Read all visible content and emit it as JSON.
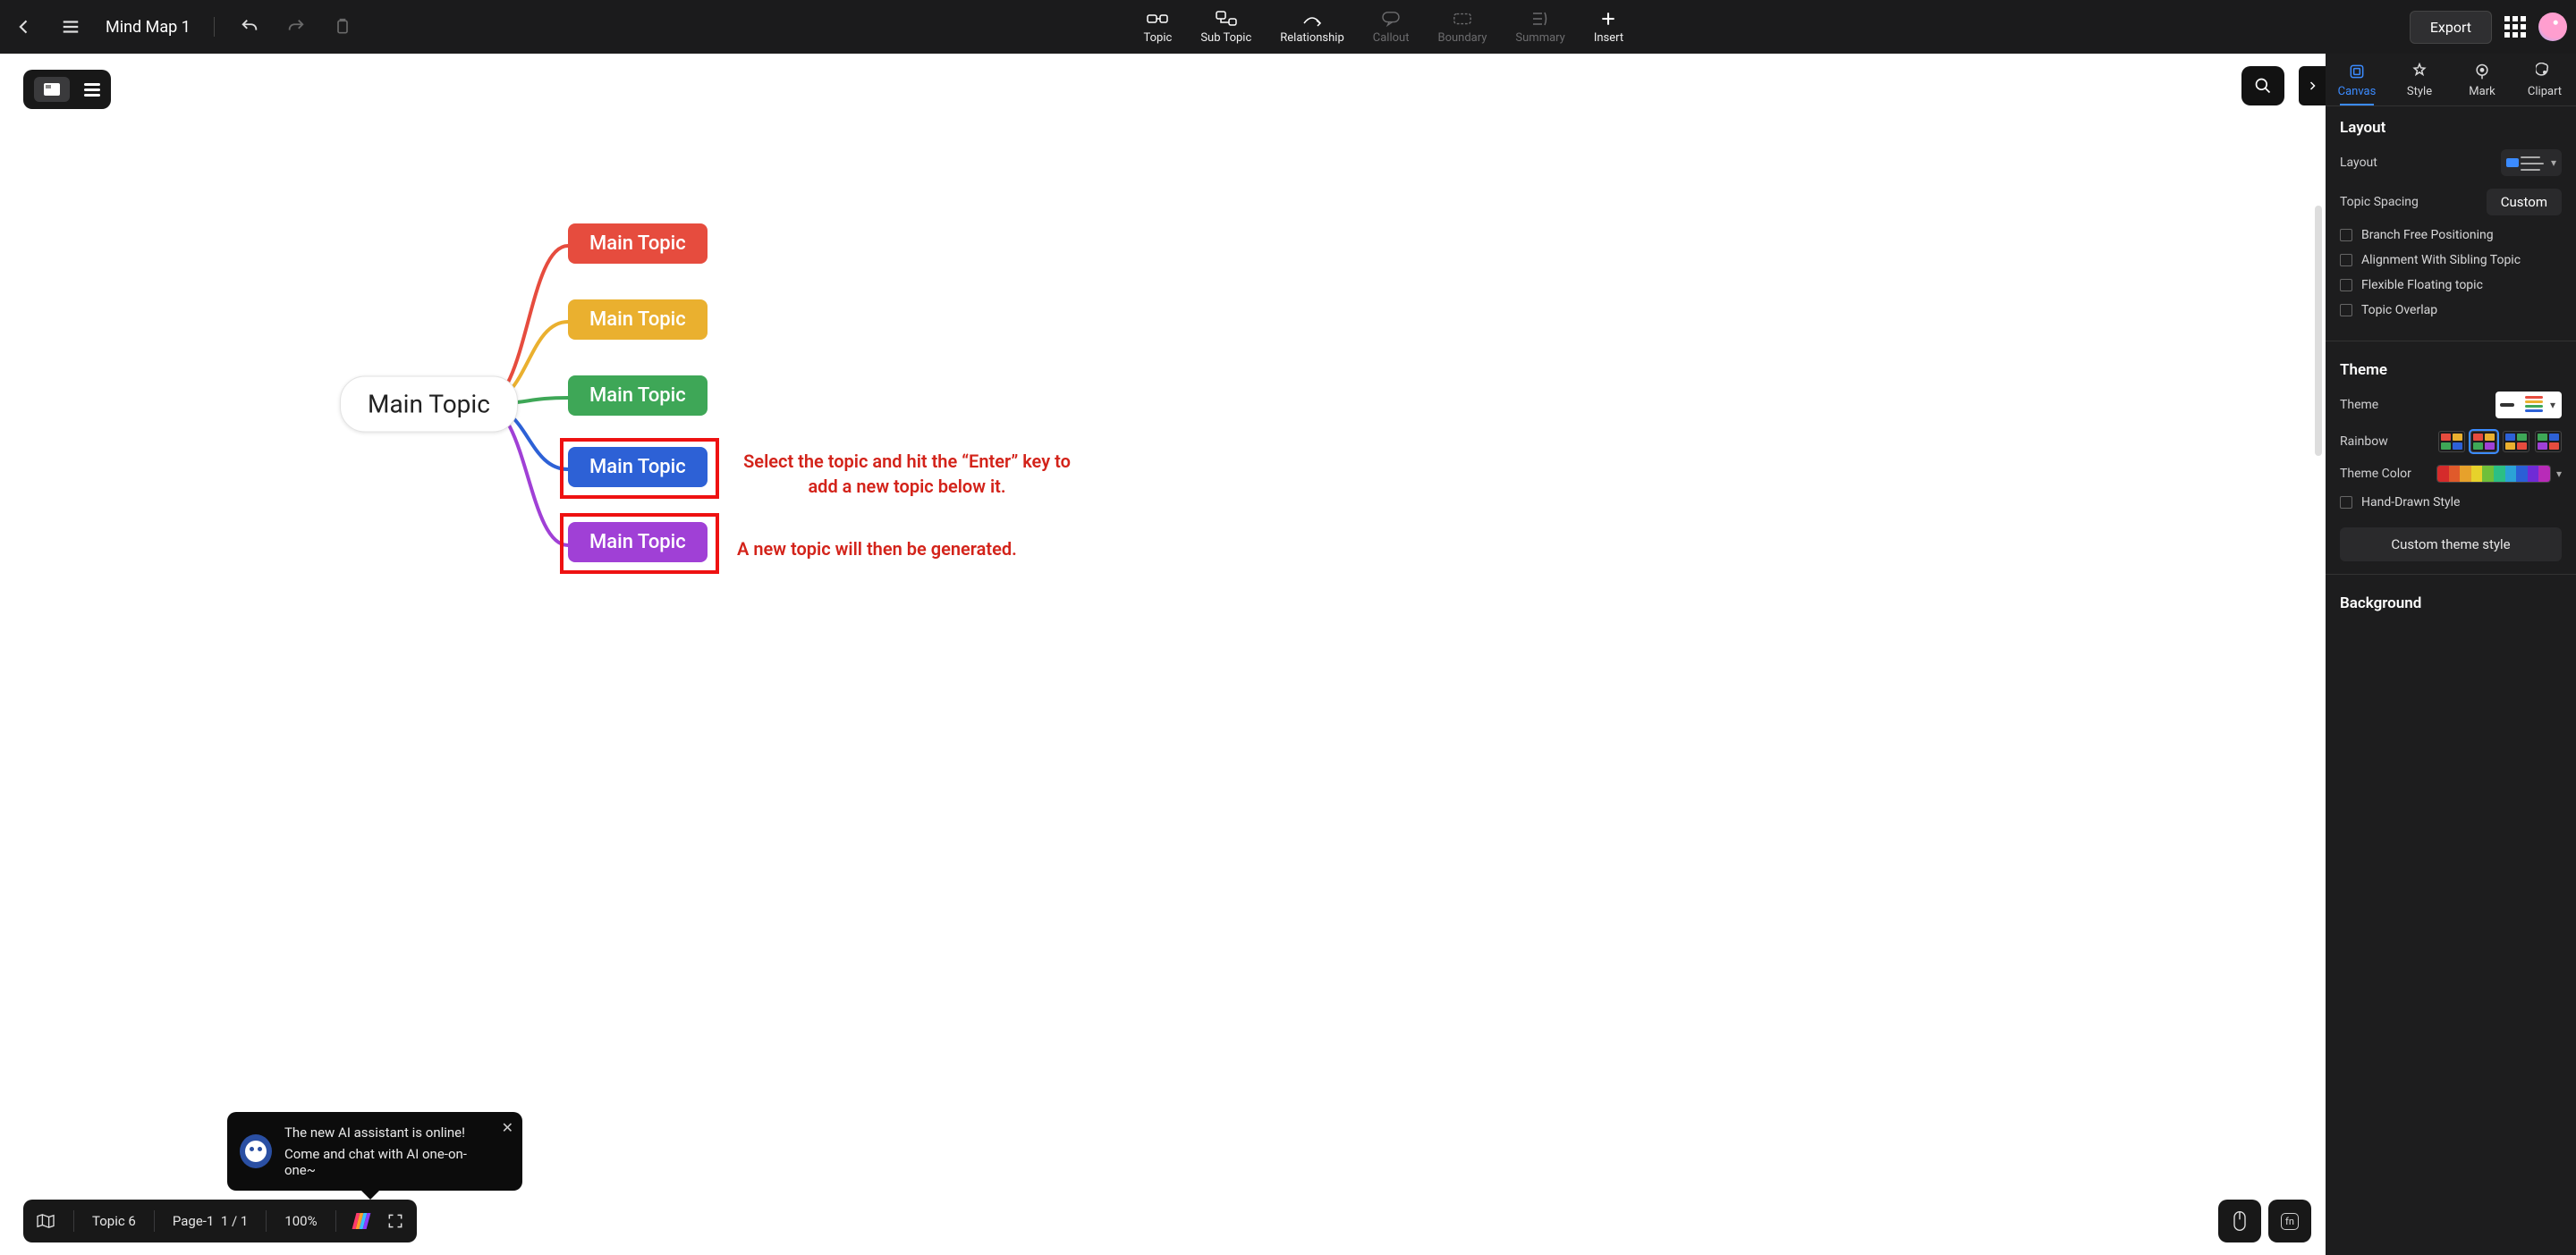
{
  "title": "Mind Map 1",
  "top_tools": {
    "topic": "Topic",
    "subtopic": "Sub Topic",
    "relationship": "Relationship",
    "callout": "Callout",
    "boundary": "Boundary",
    "summary": "Summary",
    "insert": "Insert"
  },
  "export_label": "Export",
  "mindmap": {
    "root": "Main Topic",
    "nodes": {
      "n1": "Main Topic",
      "n2": "Main Topic",
      "n3": "Main Topic",
      "n4": "Main Topic",
      "n5": "Main Topic"
    },
    "colors": {
      "n1": "#e64c3e",
      "n2": "#eab02f",
      "n3": "#3ea757",
      "n4": "#2d61d6",
      "n5": "#a040d6"
    },
    "annot1": "Select the topic and hit the “Enter” key to add a new topic below it.",
    "annot2": "A new topic will then be generated."
  },
  "right_panel": {
    "tabs": {
      "canvas": "Canvas",
      "style": "Style",
      "mark": "Mark",
      "clipart": "Clipart"
    },
    "section_layout": {
      "heading": "Layout",
      "layout_label": "Layout",
      "spacing_label": "Topic Spacing",
      "spacing_btn": "Custom",
      "cb_branch": "Branch Free Positioning",
      "cb_align": "Alignment With Sibling Topic",
      "cb_flex": "Flexible Floating topic",
      "cb_overlap": "Topic Overlap"
    },
    "section_theme": {
      "heading": "Theme",
      "theme_label": "Theme",
      "rainbow_label": "Rainbow",
      "color_label": "Theme Color",
      "cb_hand": "Hand-Drawn Style",
      "custom_btn": "Custom theme style",
      "palette": [
        "#d52b2b",
        "#e05a2b",
        "#e7a12b",
        "#e7d22b",
        "#6fbf3a",
        "#2bbf84",
        "#2ba2d6",
        "#2b5fd6",
        "#6f2bd6",
        "#b82bb8"
      ]
    },
    "section_bg": {
      "heading": "Background"
    }
  },
  "ai_toast": {
    "line1": "The new AI assistant is online!",
    "line2": "Come and chat with AI one-on-one~"
  },
  "status": {
    "topic_count": "Topic 6",
    "page_label": "Page-1",
    "page_num": "1 / 1",
    "zoom": "100%"
  }
}
